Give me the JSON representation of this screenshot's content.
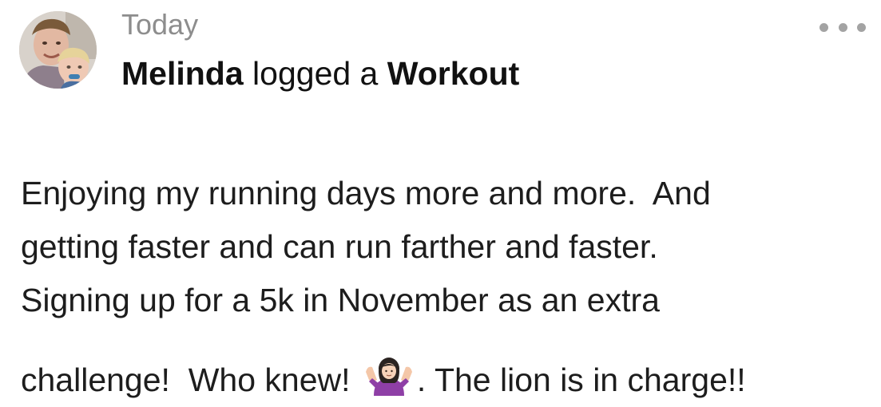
{
  "post": {
    "timestamp": "Today",
    "author": "Melinda",
    "action_text": "logged a",
    "activity_type": "Workout",
    "more_icon": "more-horizontal-icon",
    "body_lines": [
      "Enjoying my running days more and more.  And",
      "getting faster and can run farther and faster.",
      "Signing up for a 5k in November as an extra"
    ],
    "last_line_before_emoji": "challenge!  Who knew! ",
    "emoji_icon": "woman-shrugging-emoji",
    "last_line_after_emoji": ". The lion is in charge!!",
    "colors": {
      "timestamp": "#8d8d8d",
      "text": "#111111",
      "more_dots": "#a3a3a3"
    }
  }
}
